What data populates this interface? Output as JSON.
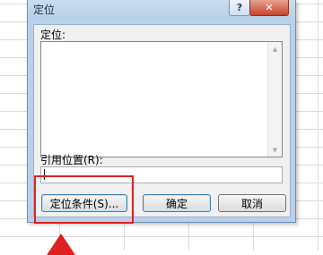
{
  "dialog": {
    "title": "定位",
    "help_glyph": "?",
    "close_glyph": "✕",
    "goto_label": "定位:",
    "reference_label": "引用位置(R):",
    "reference_value": "",
    "special_button": "定位条件(S)...",
    "ok_button": "确定",
    "cancel_button": "取消"
  },
  "colors": {
    "highlight": "#e02020",
    "dialog_frame": "#b9d1ea"
  }
}
